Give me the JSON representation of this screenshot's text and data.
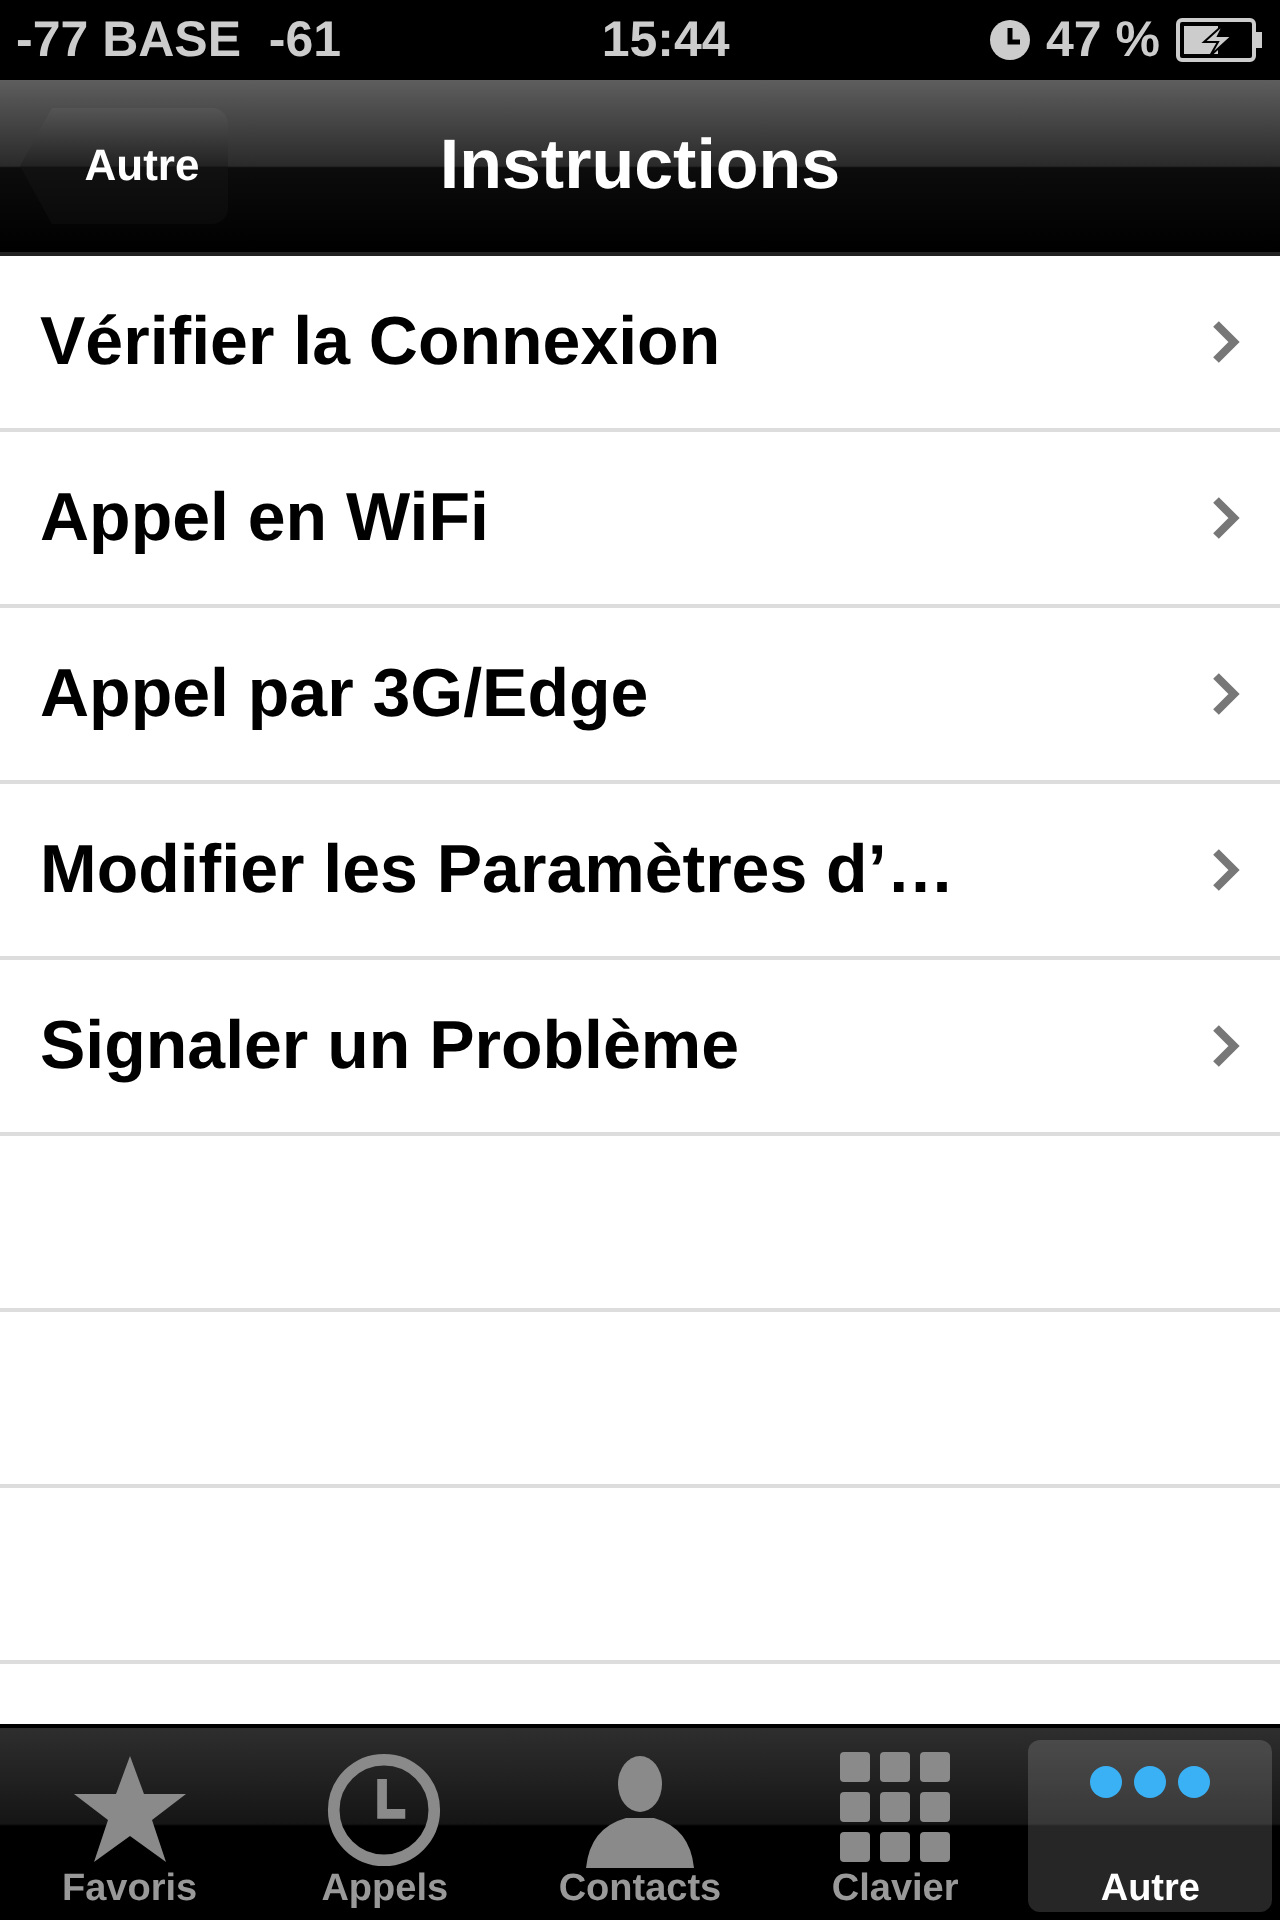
{
  "status_bar": {
    "carrier": "-77 BASE  -61",
    "time": "15:44",
    "battery": "47 %"
  },
  "nav_bar": {
    "back": "Autre",
    "title": "Instructions"
  },
  "rows": [
    {
      "label": "Vérifier la Connexion"
    },
    {
      "label": "Appel en WiFi"
    },
    {
      "label": "Appel par 3G/Edge"
    },
    {
      "label": "Modifier les Paramètres d’…"
    },
    {
      "label": "Signaler un Problème"
    }
  ],
  "tab_bar": [
    {
      "kind": "star",
      "label": "Favoris",
      "selected": false
    },
    {
      "kind": "clock",
      "label": "Appels",
      "selected": false
    },
    {
      "kind": "person",
      "label": "Contacts",
      "selected": false
    },
    {
      "kind": "keypad",
      "label": "Clavier",
      "selected": false
    },
    {
      "kind": "more",
      "label": "Autre",
      "selected": true
    }
  ]
}
